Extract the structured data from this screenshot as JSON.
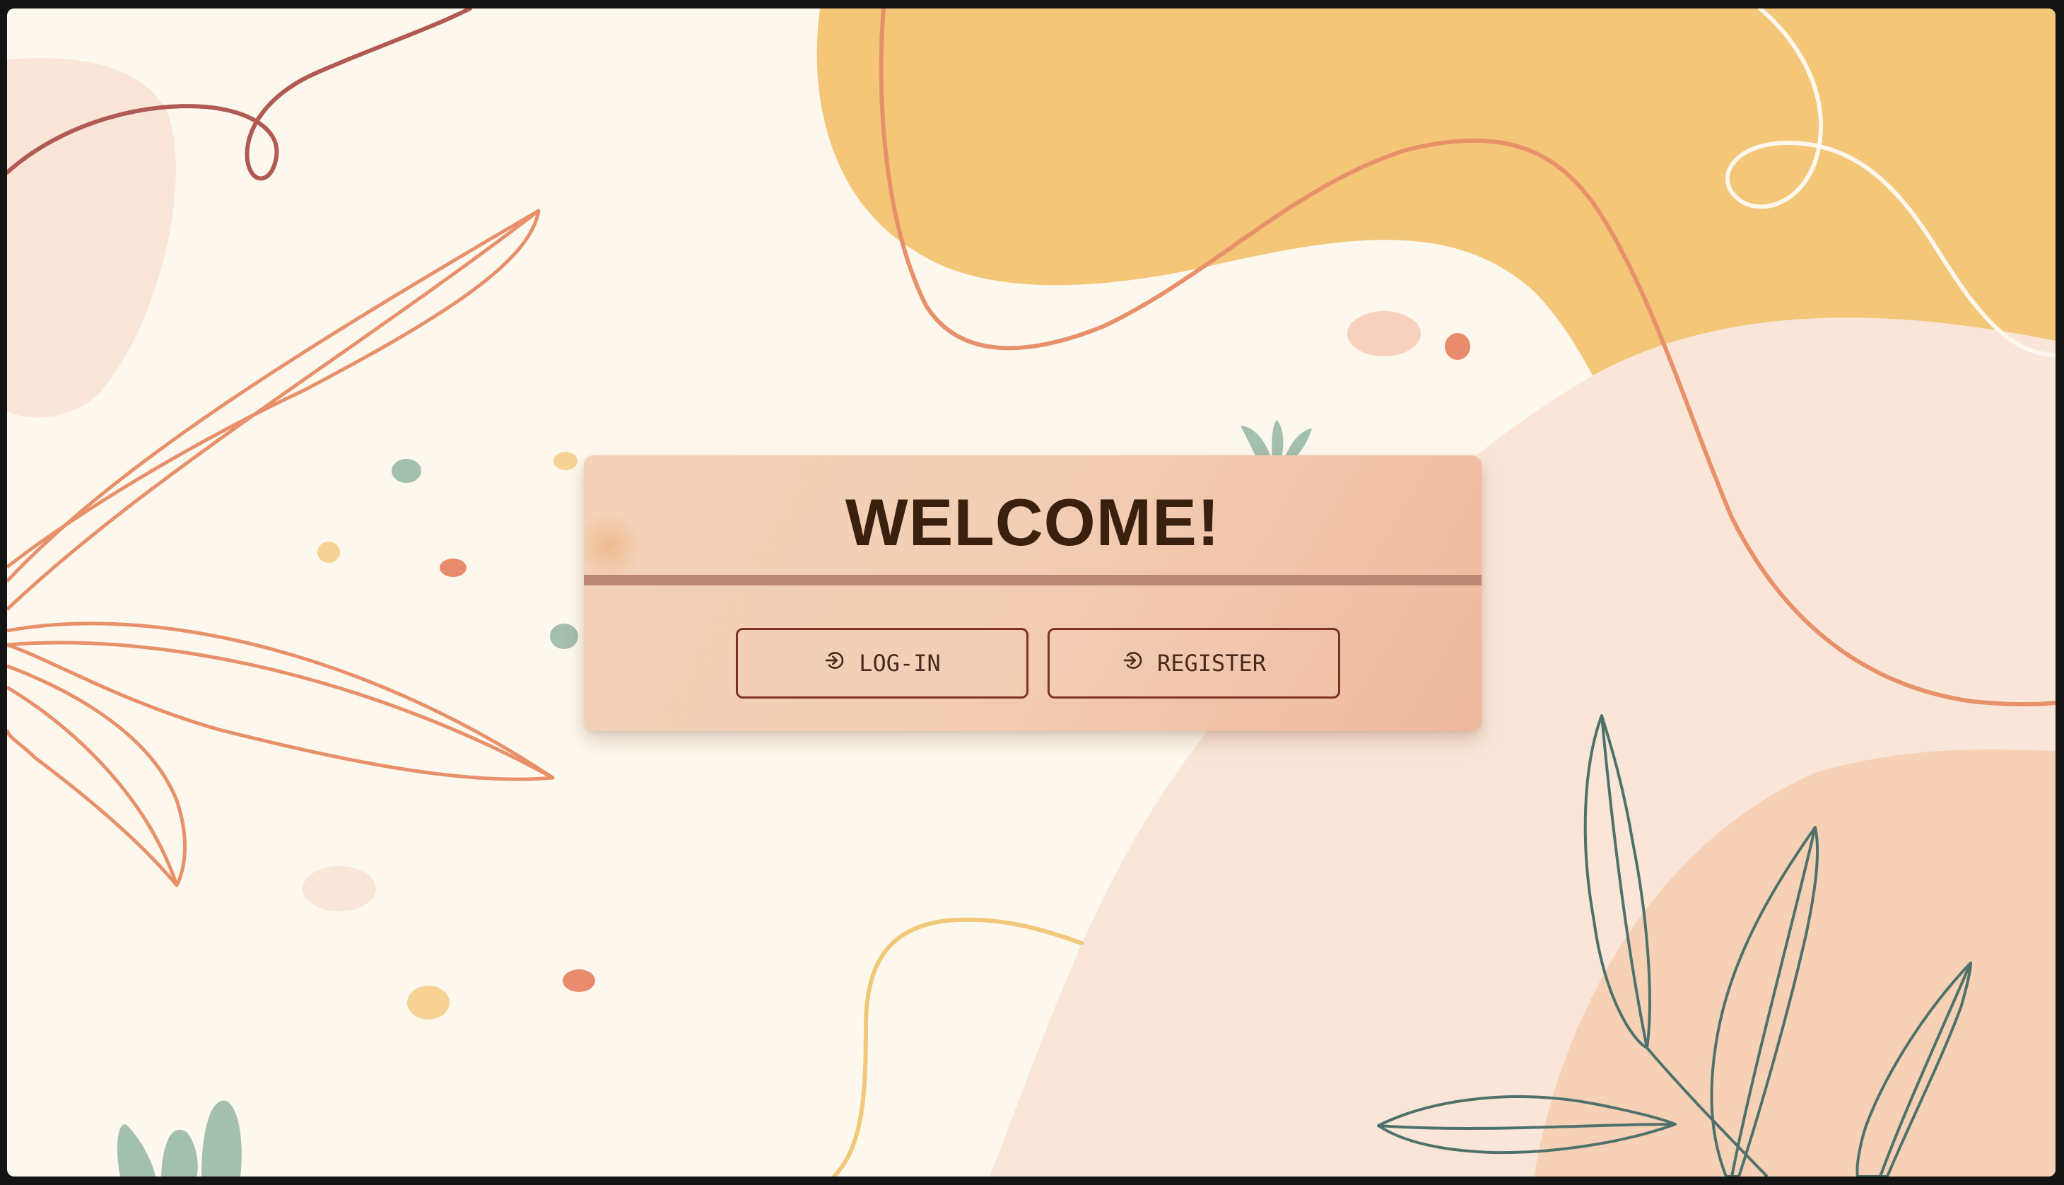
{
  "card": {
    "title": "WELCOME!"
  },
  "buttons": {
    "login": {
      "label": "LOG-IN",
      "icon": "log-in-icon"
    },
    "register": {
      "label": "REGISTER",
      "icon": "log-in-icon"
    }
  },
  "theme": {
    "background": "#fdf8ee",
    "card_color": "#f2cdb3",
    "title_color": "#3a200f",
    "button_border": "#7d3322",
    "accent_orange": "#e8906a",
    "accent_yellow": "#f3c678",
    "accent_green": "#a3bfae",
    "accent_teal_line": "#4f716b"
  }
}
